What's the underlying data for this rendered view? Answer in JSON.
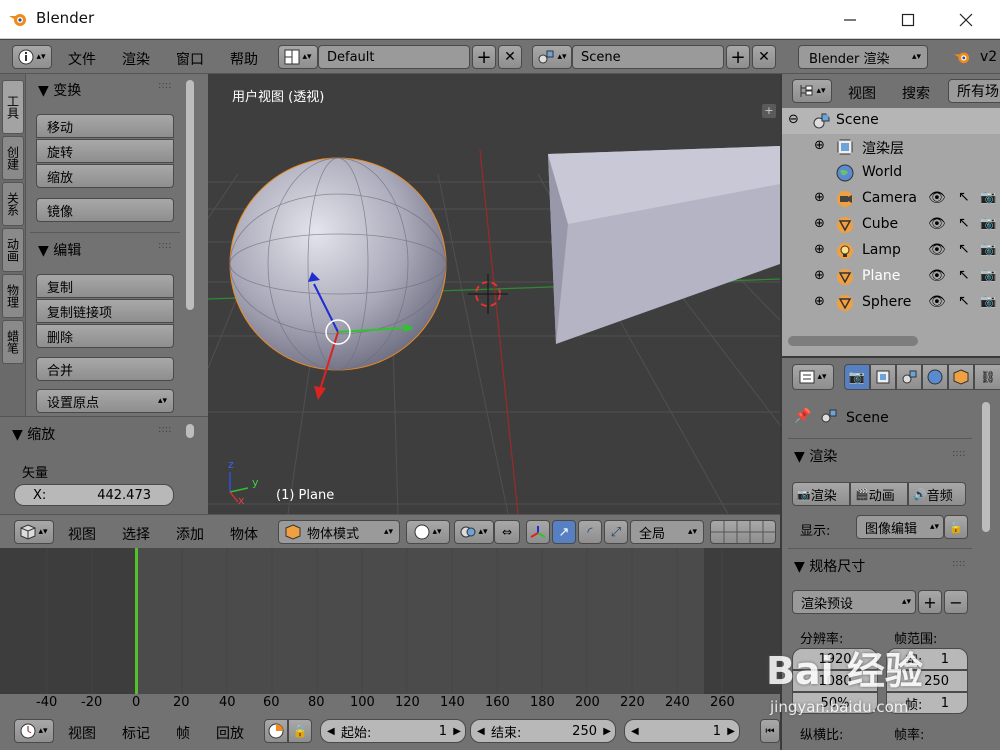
{
  "window": {
    "title": "Blender"
  },
  "info_header": {
    "menus": [
      "文件",
      "渲染",
      "窗口",
      "帮助"
    ],
    "screen_layout": "Default",
    "scene": "Scene",
    "render_engine": "Blender 渲染",
    "version": "v2"
  },
  "shelf": {
    "tabs": [
      "工具",
      "创建",
      "关系",
      "动画",
      "物理",
      "蜡笔"
    ],
    "transform": {
      "title": "变换",
      "buttons": [
        "移动",
        "旋转",
        "缩放"
      ],
      "mirror": "镜像"
    },
    "edit": {
      "title": "编辑",
      "buttons": [
        "复制",
        "复制链接项",
        "删除"
      ],
      "join": "合并",
      "set_origin": "设置原点"
    },
    "scale_panel": {
      "title": "缩放",
      "vector_label": "矢量",
      "x_label": "X:",
      "x_value": "442.473"
    }
  },
  "viewport": {
    "label": "用户视图 (透视)",
    "active_object": "(1) Plane",
    "axis_labels": [
      "z",
      "y",
      "x"
    ]
  },
  "viewport_header": {
    "menus": [
      "视图",
      "选择",
      "添加",
      "物体"
    ],
    "mode": "物体模式",
    "orientation": "全局"
  },
  "timeline": {
    "ticks": [
      "-40",
      "-20",
      "0",
      "20",
      "40",
      "60",
      "80",
      "100",
      "120",
      "140",
      "160",
      "180",
      "200",
      "220",
      "240",
      "260"
    ],
    "menus": [
      "视图",
      "标记",
      "帧",
      "回放"
    ],
    "start_label": "起始:",
    "start_value": "1",
    "end_label": "结束:",
    "end_value": "250",
    "current": "1"
  },
  "outliner": {
    "menus": [
      "视图",
      "搜索",
      "所有场"
    ],
    "rows": [
      {
        "label": "Scene"
      },
      {
        "label": "渲染层"
      },
      {
        "label": "World"
      },
      {
        "label": "Camera"
      },
      {
        "label": "Cube"
      },
      {
        "label": "Lamp"
      },
      {
        "label": "Plane"
      },
      {
        "label": "Sphere"
      }
    ]
  },
  "properties": {
    "scene_label": "Scene",
    "render_panel": {
      "title": "渲染",
      "buttons": [
        "渲染",
        "动画",
        "音频"
      ],
      "display_label": "显示:",
      "display_value": "图像编辑"
    },
    "dimensions_panel": {
      "title": "规格尺寸",
      "preset": "渲染预设",
      "resolution_label": "分辨率:",
      "frame_range_label": "帧范围:",
      "res_x": "1920",
      "res_y": "1080",
      "res_pct": "50%",
      "start_label": "起:",
      "start_value": "1",
      "end_value": "250",
      "step_label": "帧:",
      "step_value": "1",
      "aspect_label": "纵横比:",
      "fps_label": "帧率:"
    }
  },
  "watermark": {
    "logo": "Bai 经验",
    "url": "jingyan.baidu.com"
  },
  "colors": {
    "accent_green": "#55c02c",
    "blender_orange": "#f08a1c",
    "panel": "#727272",
    "viewport": "#3e3e3e"
  }
}
